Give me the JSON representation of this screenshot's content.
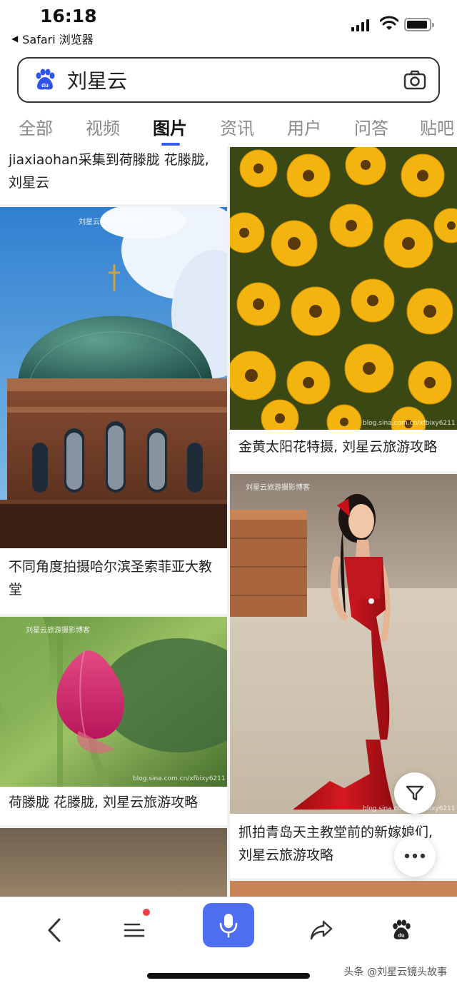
{
  "status_bar": {
    "time": "16:18",
    "back_app": "Safari 浏览器"
  },
  "search": {
    "query": "刘星云",
    "logo_icon": "baidu-paw-icon",
    "camera_icon": "camera-icon"
  },
  "tabs": [
    {
      "label": "全部"
    },
    {
      "label": "视频"
    },
    {
      "label": "图片",
      "active": true
    },
    {
      "label": "资讯"
    },
    {
      "label": "用户"
    },
    {
      "label": "问答"
    },
    {
      "label": "贴吧"
    }
  ],
  "feed": {
    "left": [
      {
        "caption": "jiaxiaohan采集到荷滕胧 花滕胧, 刘星云"
      },
      {
        "caption": "不同角度拍摄哈尔滨圣索菲亚大教堂",
        "watermark": "刘星云旅游摄影博客"
      },
      {
        "caption": "荷滕胧 花滕胧, 刘星云旅游攻略",
        "watermark": "刘星云旅游摄影博客",
        "source": "blog.sina.com.cn/xfbixy6211"
      }
    ],
    "right": [
      {
        "caption": "金黄太阳花特摄, 刘星云旅游攻略",
        "source": "blog.sina.com.cn/xfbixy6211"
      },
      {
        "caption": "抓拍青岛天主教堂前的新嫁娘们, 刘星云旅游攻略",
        "watermark": "刘星云旅游摄影博客",
        "source": "blog.sina.com.cn/xfbixy6211"
      }
    ]
  },
  "colors": {
    "accent": "#4e6ef2",
    "tab_underline": "#3b5cf0",
    "notification": "#f04142"
  },
  "bottom_bar": {
    "credit": "头条 @刘星云镜头故事"
  }
}
